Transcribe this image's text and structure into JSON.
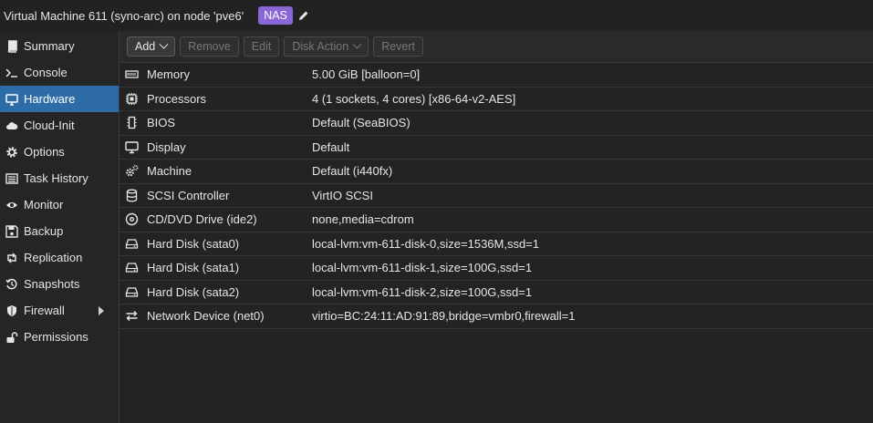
{
  "header": {
    "title": "Virtual Machine 611 (syno-arc) on node 'pve6'",
    "tag": "NAS"
  },
  "sidebar": {
    "items": [
      {
        "label": "Summary",
        "icon": "book-icon"
      },
      {
        "label": "Console",
        "icon": "terminal-icon"
      },
      {
        "label": "Hardware",
        "icon": "desktop-icon",
        "active": true
      },
      {
        "label": "Cloud-Init",
        "icon": "cloud-icon"
      },
      {
        "label": "Options",
        "icon": "gear-icon"
      },
      {
        "label": "Task History",
        "icon": "list-icon"
      },
      {
        "label": "Monitor",
        "icon": "eye-icon"
      },
      {
        "label": "Backup",
        "icon": "floppy-icon"
      },
      {
        "label": "Replication",
        "icon": "retweet-icon"
      },
      {
        "label": "Snapshots",
        "icon": "history-icon"
      },
      {
        "label": "Firewall",
        "icon": "shield-icon",
        "has_submenu": true
      },
      {
        "label": "Permissions",
        "icon": "unlock-icon"
      }
    ]
  },
  "toolbar": {
    "add_label": "Add",
    "remove_label": "Remove",
    "edit_label": "Edit",
    "disk_action_label": "Disk Action",
    "revert_label": "Revert"
  },
  "hardware": {
    "rows": [
      {
        "name": "Memory",
        "value": "5.00 GiB [balloon=0]",
        "icon": "memory-icon"
      },
      {
        "name": "Processors",
        "value": "4 (1 sockets, 4 cores) [x86-64-v2-AES]",
        "icon": "cpu-icon"
      },
      {
        "name": "BIOS",
        "value": "Default (SeaBIOS)",
        "icon": "chip-icon"
      },
      {
        "name": "Display",
        "value": "Default",
        "icon": "display-icon"
      },
      {
        "name": "Machine",
        "value": "Default (i440fx)",
        "icon": "cogs-icon"
      },
      {
        "name": "SCSI Controller",
        "value": "VirtIO SCSI",
        "icon": "database-icon"
      },
      {
        "name": "CD/DVD Drive (ide2)",
        "value": "none,media=cdrom",
        "icon": "cdrom-icon"
      },
      {
        "name": "Hard Disk (sata0)",
        "value": "local-lvm:vm-611-disk-0,size=1536M,ssd=1",
        "icon": "hdd-icon"
      },
      {
        "name": "Hard Disk (sata1)",
        "value": "local-lvm:vm-611-disk-1,size=100G,ssd=1",
        "icon": "hdd-icon"
      },
      {
        "name": "Hard Disk (sata2)",
        "value": "local-lvm:vm-611-disk-2,size=100G,ssd=1",
        "icon": "hdd-icon"
      },
      {
        "name": "Network Device (net0)",
        "value": "virtio=BC:24:11:AD:91:89,bridge=vmbr0,firewall=1",
        "icon": "exchange-icon"
      }
    ]
  },
  "colors": {
    "accent": "#2e6ca8",
    "tag": "#8a66d6",
    "background": "#252525"
  }
}
